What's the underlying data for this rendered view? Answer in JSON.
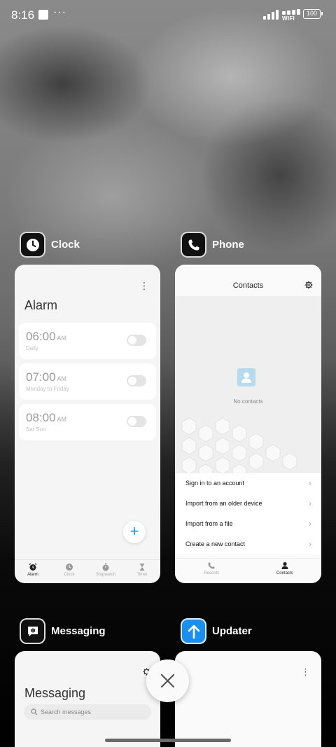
{
  "status_bar": {
    "time": "8:16",
    "more": "···",
    "wifi_label": "WIFI",
    "battery": "100"
  },
  "apps": {
    "clock": {
      "name": "Clock",
      "icon": "clock-icon",
      "screen_title": "Alarm",
      "alarms": [
        {
          "time": "06:00",
          "ampm": "AM",
          "repeat": "Daily",
          "enabled": false
        },
        {
          "time": "07:00",
          "ampm": "AM",
          "repeat": "Monday to Friday",
          "enabled": false
        },
        {
          "time": "08:00",
          "ampm": "AM",
          "repeat": "Sat Sun",
          "enabled": false
        }
      ],
      "nav": [
        {
          "label": "Alarm",
          "icon": "alarm-icon",
          "active": true
        },
        {
          "label": "Clock",
          "icon": "clock-icon",
          "active": false
        },
        {
          "label": "Stopwatch",
          "icon": "stopwatch-icon",
          "active": false
        },
        {
          "label": "Timer",
          "icon": "hourglass-icon",
          "active": false
        }
      ]
    },
    "phone": {
      "name": "Phone",
      "icon": "phone-icon",
      "screen_title": "Contacts",
      "empty_text": "No contacts",
      "menu": [
        "Sign in to an account",
        "Import from an older device",
        "Import from a file",
        "Create a new contact"
      ],
      "nav": [
        {
          "label": "Recents",
          "icon": "phone-icon",
          "active": false
        },
        {
          "label": "Contacts",
          "icon": "person-icon",
          "active": true
        }
      ]
    },
    "messaging": {
      "name": "Messaging",
      "icon": "message-icon",
      "screen_title": "Messaging",
      "search_placeholder": "Search messages"
    },
    "updater": {
      "name": "Updater",
      "icon": "arrow-up-icon"
    }
  },
  "colors": {
    "accent": "#1a8ff0",
    "card_bg": "#f5f5f5"
  }
}
